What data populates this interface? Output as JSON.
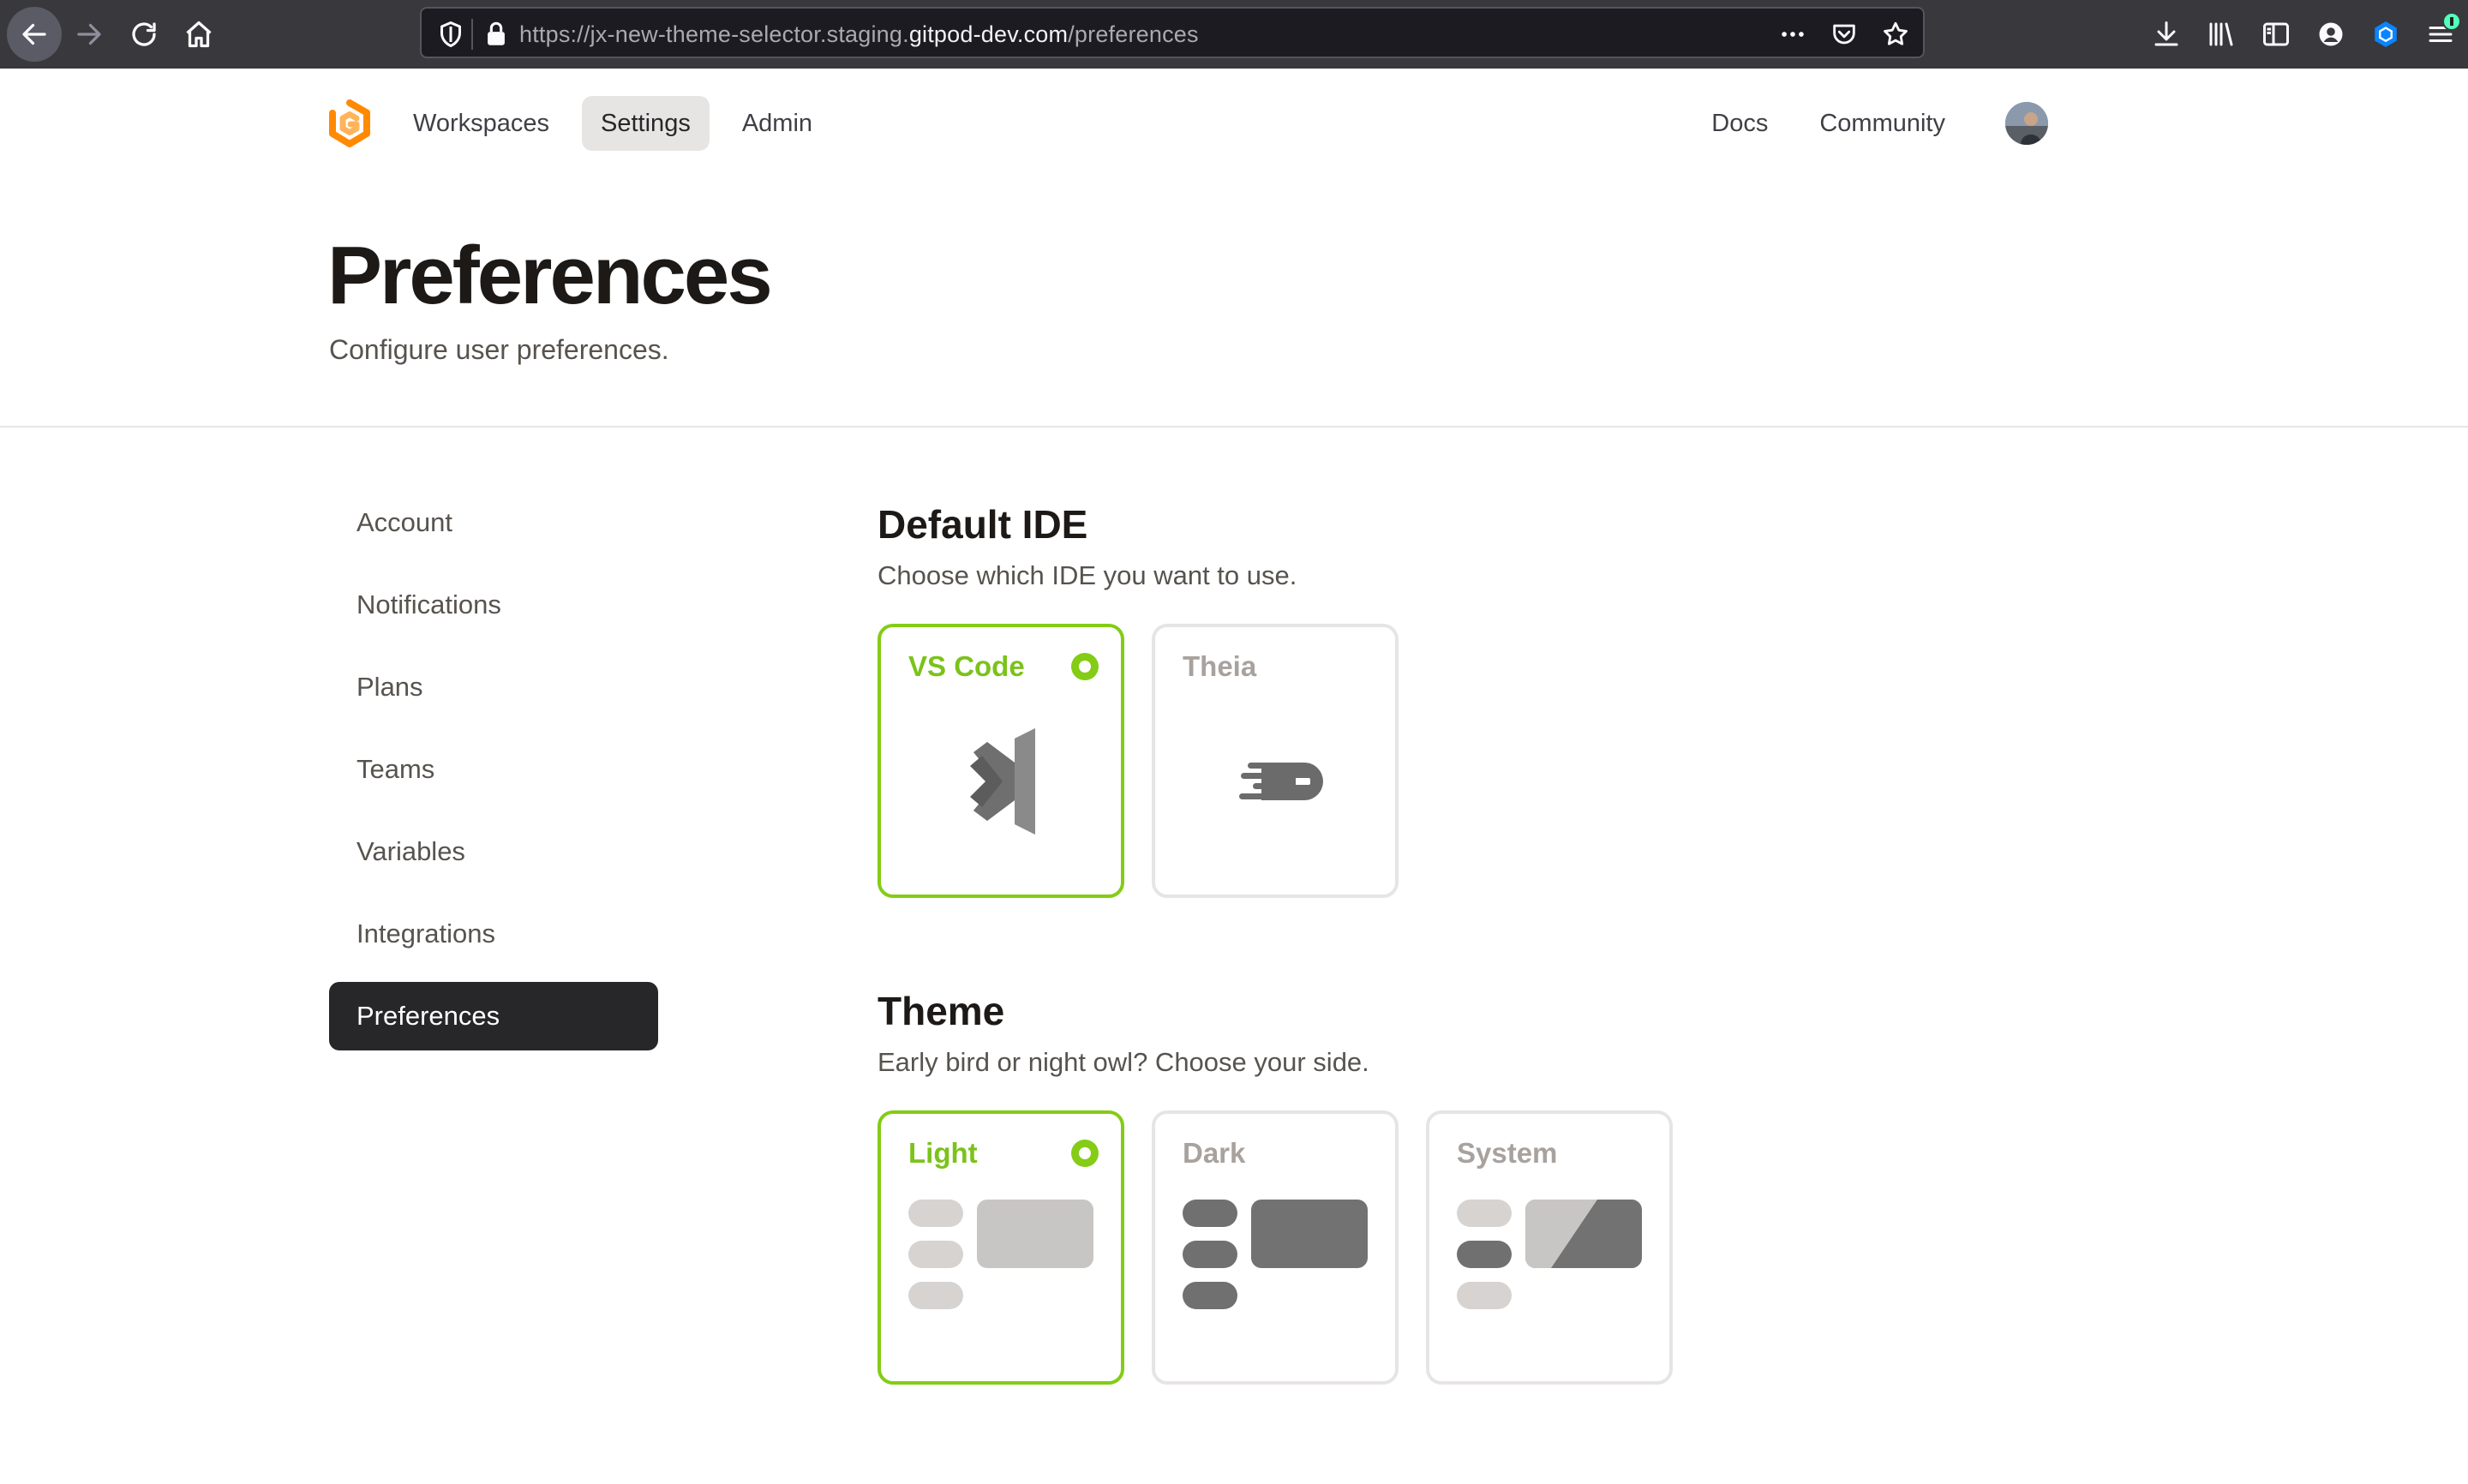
{
  "browser": {
    "url_prefix": "https://jx-new-theme-selector.staging.",
    "url_host": "gitpod-dev.com",
    "url_path": "/preferences",
    "icons": [
      "back-arrow-icon",
      "forward-arrow-icon",
      "reload-icon",
      "home-icon",
      "shield-icon",
      "lock-icon",
      "more-dots-icon",
      "pocket-icon",
      "bookmark-star-icon",
      "download-icon",
      "library-icon",
      "sidebar-icon",
      "account-icon",
      "extension-icon",
      "menu-icon"
    ]
  },
  "nav": {
    "logo_icon": "gitpod-logo-icon",
    "left": [
      {
        "label": "Workspaces",
        "active": false
      },
      {
        "label": "Settings",
        "active": true
      },
      {
        "label": "Admin",
        "active": false
      }
    ],
    "right": [
      {
        "label": "Docs"
      },
      {
        "label": "Community"
      }
    ]
  },
  "header": {
    "title": "Preferences",
    "subtitle": "Configure user preferences."
  },
  "sidebar": {
    "items": [
      {
        "label": "Account",
        "active": false
      },
      {
        "label": "Notifications",
        "active": false
      },
      {
        "label": "Plans",
        "active": false
      },
      {
        "label": "Teams",
        "active": false
      },
      {
        "label": "Variables",
        "active": false
      },
      {
        "label": "Integrations",
        "active": false
      },
      {
        "label": "Preferences",
        "active": true
      }
    ]
  },
  "ide": {
    "title": "Default IDE",
    "description": "Choose which IDE you want to use.",
    "options": [
      {
        "label": "VS Code",
        "selected": true,
        "icon": "vscode-logo-icon"
      },
      {
        "label": "Theia",
        "selected": false,
        "icon": "theia-logo-icon"
      }
    ]
  },
  "theme": {
    "title": "Theme",
    "description": "Early bird or night owl? Choose your side.",
    "options": [
      {
        "label": "Light",
        "selected": true,
        "icon": "light-theme-preview"
      },
      {
        "label": "Dark",
        "selected": false,
        "icon": "dark-theme-preview"
      },
      {
        "label": "System",
        "selected": false,
        "icon": "system-theme-preview"
      }
    ]
  },
  "colors": {
    "accent_green": "#84cc16",
    "active_sidebar_bg": "#27272a",
    "active_nav_bg": "#e7e5e4",
    "brand_orange": "#ff8a00"
  }
}
